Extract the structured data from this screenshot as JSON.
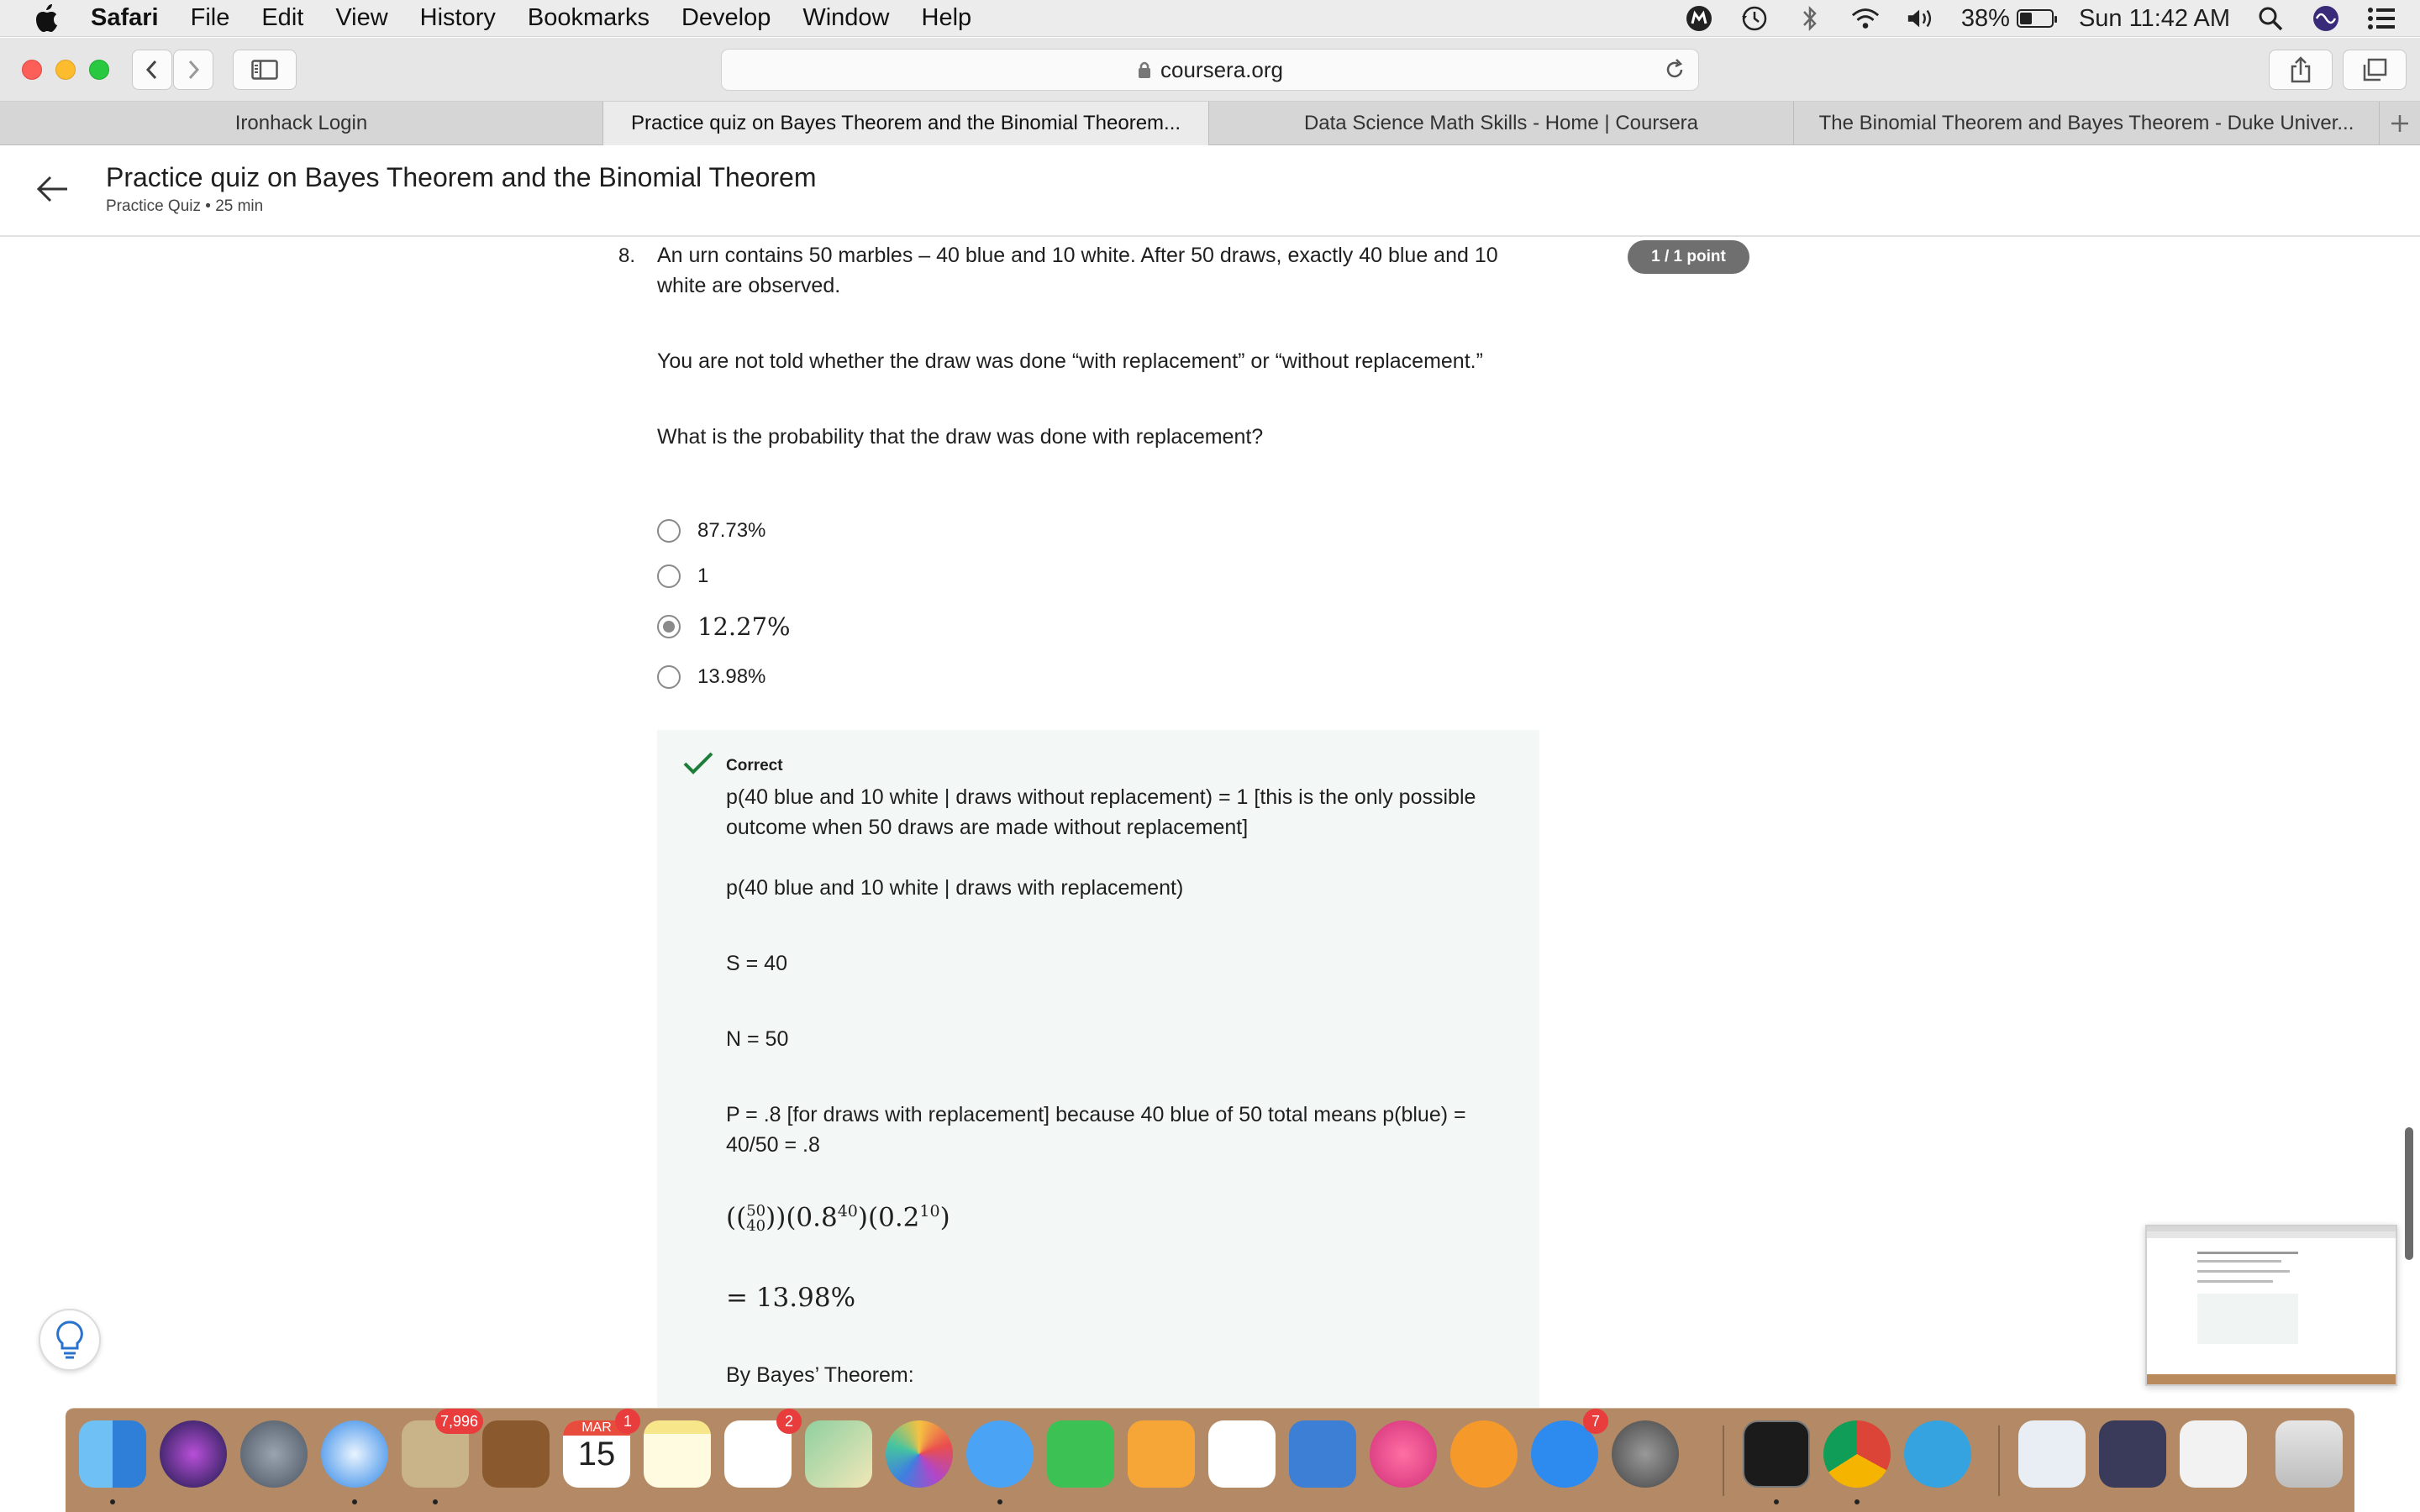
{
  "menubar": {
    "app_name": "Safari",
    "items": [
      "File",
      "Edit",
      "View",
      "History",
      "Bookmarks",
      "Develop",
      "Window",
      "Help"
    ],
    "battery_percent": "38%",
    "battery_level": 0.38,
    "clock": "Sun 11:42 AM"
  },
  "browser": {
    "url": "coursera.org",
    "tabs": [
      {
        "title": "Ironhack Login",
        "active": false
      },
      {
        "title": "Practice quiz on Bayes Theorem and the Binomial Theorem...",
        "active": true
      },
      {
        "title": "Data Science Math Skills - Home | Coursera",
        "active": false
      },
      {
        "title": "The Binomial Theorem and Bayes Theorem - Duke Univer...",
        "active": false
      }
    ]
  },
  "course_header": {
    "title": "Practice quiz on Bayes Theorem and the Binomial Theorem",
    "subtitle": "Practice Quiz • 25 min"
  },
  "question": {
    "number": "8.",
    "points": "1 / 1 point",
    "paragraphs": [
      "An urn contains 50 marbles – 40 blue and 10 white. After 50 draws, exactly 40 blue and 10 white are observed.",
      "You are not told whether the draw was done “with replacement” or “without replacement.”",
      "What is the probability that the draw was done with replacement?"
    ],
    "options": [
      {
        "label": "87.73%",
        "selected": false
      },
      {
        "label": "1",
        "selected": false
      },
      {
        "label": "12.27%",
        "selected": true
      },
      {
        "label": "13.98%",
        "selected": false
      }
    ]
  },
  "feedback": {
    "status": "Correct",
    "lines": [
      "p(40 blue and 10 white | draws without replacement) = 1 [this is the only possible outcome when 50 draws are made without replacement]",
      "p(40 blue and 10 white | draws with replacement)",
      "S = 40",
      "N = 50",
      "P = .8 [for draws with replacement] because 40 blue of 50 total means p(blue) = 40/50 = .8"
    ],
    "formula": {
      "binom_top": "50",
      "binom_bottom": "40",
      "base1": "(0.8",
      "exp1": "40",
      "base2": ")(0.2",
      "exp2": "10"
    },
    "result": "= 13.98%",
    "next_heading": "By Bayes’ Theorem:"
  },
  "dock": {
    "mail_badge": "7,996",
    "calendar_month": "MAR",
    "calendar_day": "15",
    "calendar_badge": "1",
    "reminders_badge": "2",
    "appstore_badge": "7"
  },
  "colors": {
    "points_badge": "#6f6f6f",
    "feedback_bg": "#f3f8f6",
    "check_green": "#1e7d3a",
    "badge_red": "#e93d3d"
  }
}
